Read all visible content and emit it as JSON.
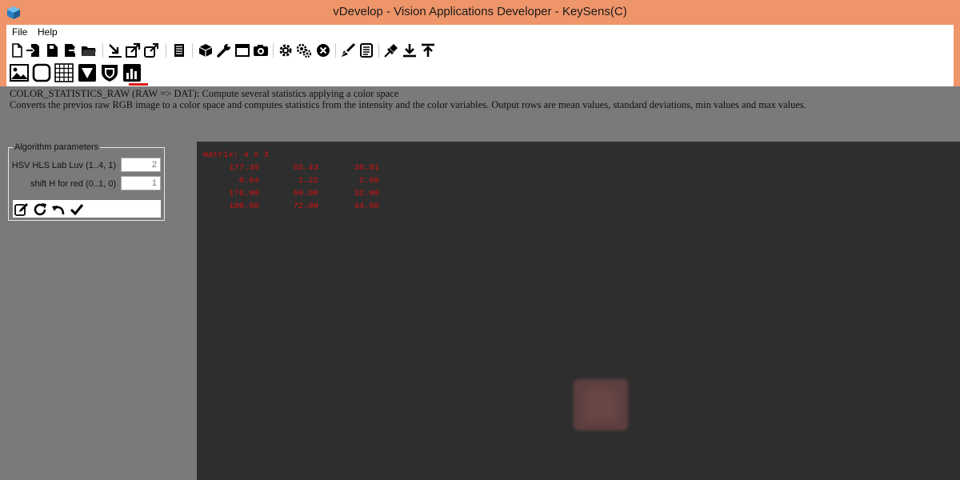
{
  "window": {
    "title": "vDevelop - Vision Applications Developer - KeySens(C)"
  },
  "menu": {
    "items": [
      "File",
      "Help"
    ]
  },
  "toolbar": {
    "icons": [
      "new-file-icon",
      "import-icon",
      "save-icon",
      "export-icon",
      "open-folder-icon",
      "step-in-icon",
      "share-icon",
      "external-link-icon",
      "document-icon",
      "cube-icon",
      "wrench-icon",
      "window-icon",
      "camera-icon",
      "gear-icon",
      "gears-icon",
      "stop-icon",
      "brush-icon",
      "list-icon",
      "pin-icon",
      "download-icon",
      "upload-icon"
    ]
  },
  "modebar": {
    "icons": [
      "image-icon",
      "shape-icon",
      "grid-icon",
      "funnel-icon",
      "shield-icon",
      "bar-chart-icon"
    ],
    "active": "bar-chart-icon"
  },
  "description": {
    "line1": "COLOR_STATISTICS_RAW (RAW => DAT): Compute several statistics applying a color space",
    "line2": "Converts the previos raw RGB image to a color space and computes statistics from the intensity and the color variables. Output rows are mean values, standard deviations, min values and max values."
  },
  "params": {
    "legend": "Algorithm parameters",
    "rows": [
      {
        "label": "HSV HLS Lab Luv (1..4, 1)",
        "value": "2"
      },
      {
        "label": "shift H for red (0..1, 0)",
        "value": "1"
      }
    ],
    "actions": [
      "edit-icon",
      "refresh-icon",
      "undo-icon",
      "check-icon"
    ]
  },
  "viewer": {
    "header": "matrix: 4 x 3",
    "rows": [
      [
        "177.49",
        "65.43",
        "38.81"
      ],
      [
        "0.64",
        "1.22",
        "2.09"
      ],
      [
        "176.00",
        "60.00",
        "32.00"
      ],
      [
        "180.00",
        "72.00",
        "44.00"
      ]
    ]
  },
  "colors": {
    "titlebar": "#ef956a",
    "accent": "#e01a1a",
    "matrix_text": "#d60f0f"
  }
}
